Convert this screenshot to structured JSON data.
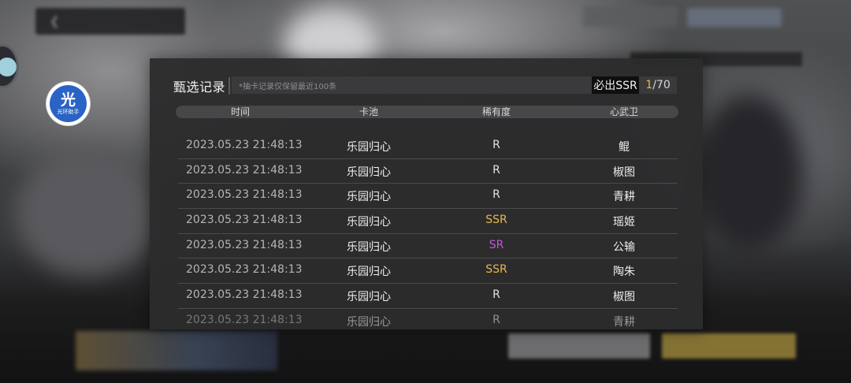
{
  "dialog": {
    "title": "甄选记录",
    "notice": "*抽卡记录仅保留最近100条",
    "pity": {
      "label": "必出SSR",
      "current": "1",
      "separator": "/",
      "total": "70"
    },
    "columns": [
      "时间",
      "卡池",
      "稀有度",
      "心武卫"
    ],
    "rows": [
      {
        "time": "2023.05.23  21:48:13",
        "pool": "乐园归心",
        "rarity": "R",
        "weapon": "鲲"
      },
      {
        "time": "2023.05.23  21:48:13",
        "pool": "乐园归心",
        "rarity": "R",
        "weapon": "椒图"
      },
      {
        "time": "2023.05.23  21:48:13",
        "pool": "乐园归心",
        "rarity": "R",
        "weapon": "青耕"
      },
      {
        "time": "2023.05.23  21:48:13",
        "pool": "乐园归心",
        "rarity": "SSR",
        "weapon": "瑶姬"
      },
      {
        "time": "2023.05.23  21:48:13",
        "pool": "乐园归心",
        "rarity": "SR",
        "weapon": "公输"
      },
      {
        "time": "2023.05.23  21:48:13",
        "pool": "乐园归心",
        "rarity": "SSR",
        "weapon": "陶朱"
      },
      {
        "time": "2023.05.23  21:48:13",
        "pool": "乐园归心",
        "rarity": "R",
        "weapon": "椒图"
      },
      {
        "time": "2023.05.23  21:48:13",
        "pool": "乐园归心",
        "rarity": "R",
        "weapon": "青耕"
      }
    ]
  },
  "assistant_badge": {
    "glyph": "光",
    "caption": "光环助手"
  },
  "colors": {
    "rarity_R": "#e2e2e2",
    "rarity_SR": "#c457d8",
    "rarity_SSR": "#e8b94a",
    "pity_current": "#e5b84a",
    "assistant_blue": "#2a63c6"
  }
}
